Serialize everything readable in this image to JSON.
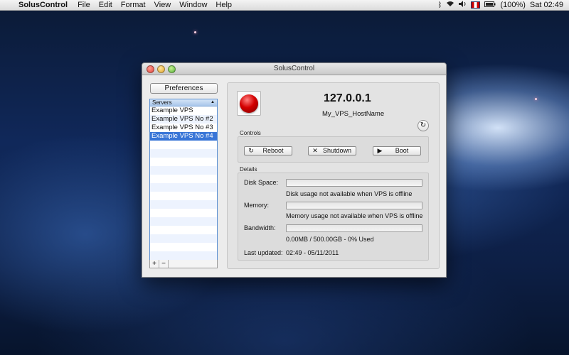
{
  "menubar": {
    "app_name": "SolusControl",
    "items": [
      "File",
      "Edit",
      "Format",
      "View",
      "Window",
      "Help"
    ],
    "battery": "(100%)",
    "clock": "Sat 02:49"
  },
  "window": {
    "title": "SolusControl",
    "preferences_label": "Preferences",
    "servers_header": "Servers",
    "servers": [
      "Example VPS",
      "Example VPS No #2",
      "Example VPS No #3",
      "Example VPS No #4"
    ],
    "selected_index": 3,
    "add_label": "+",
    "remove_label": "−"
  },
  "server": {
    "status_color": "#d40000",
    "ip": "127.0.0.1",
    "hostname": "My_VPS_HostName",
    "refresh_icon": "refresh-icon"
  },
  "controls": {
    "section_label": "Controls",
    "reboot_label": "Reboot",
    "shutdown_label": "Shutdown",
    "boot_label": "Boot"
  },
  "details": {
    "section_label": "Details",
    "disk_label": "Disk Space:",
    "disk_text": "Disk usage not available when VPS is offline",
    "memory_label": "Memory:",
    "memory_text": "Memory usage not available when VPS is offline",
    "bandwidth_label": "Bandwidth:",
    "bandwidth_text": "0.00MB / 500.00GB - 0% Used",
    "updated_label": "Last updated:",
    "updated_value": "02:49 - 05/11/2011"
  },
  "colors": {
    "selection": "#3875d7",
    "status_offline": "#d40000"
  }
}
